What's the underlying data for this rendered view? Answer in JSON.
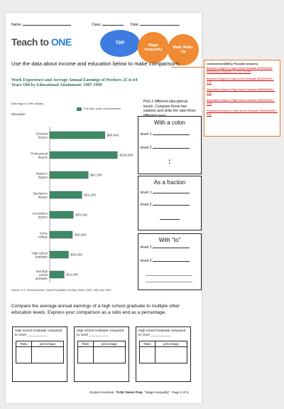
{
  "header": {
    "name_label": "Name:",
    "class_label": "Class:",
    "date_label": "Date:"
  },
  "logo": {
    "part1": "Teach to ",
    "part2": "ONE"
  },
  "bubbles": {
    "tdp": "TDP",
    "wage": "Wage Inequality",
    "math": "Math Write-Up"
  },
  "instruction": "Use the data about income and education below to make comparisons.",
  "chart_data": {
    "type": "bar",
    "title": "Work Experience and Average Annual Earnings of Workers 25 to 64 Years Old by Educational Attainment: 1997-1999",
    "subtitle": "(Earnings in 1999 dollars)",
    "ylabel": "Education",
    "legend": "Full-time, year-round workers",
    "categories": [
      "Doctoral degree",
      "Professional degree",
      "Master's degree",
      "Bachelor's degree",
      "Associate's degree",
      "Some college",
      "High school graduate",
      "Not high school graduate"
    ],
    "values": [
      89400,
      109600,
      62300,
      52200,
      38200,
      36800,
      30400,
      23400
    ],
    "value_labels": [
      "$89,400",
      "$109,600",
      "$62,300",
      "$52,200",
      "$38,200",
      "$36,800",
      "$30,400",
      "$23,400"
    ],
    "xlim": [
      0,
      115000
    ],
    "bar_color": "#3f8a66",
    "source": "Source: U.S. Census Bureau, Current Population Surveys, March 1998, 1999, and 2000."
  },
  "pick_instructions": "Pick 2 different educational levels. Compare those two salaries and write the ratio three different ways.",
  "panels": [
    {
      "title": "With a colon",
      "level1": "level 1",
      "level2": "level 2",
      "symbol": ":"
    },
    {
      "title": "As a fraction",
      "level1": "level 1",
      "level2": "level 2"
    },
    {
      "title": "With \"to\"",
      "level1": "level 1",
      "level2": "level 2"
    }
  ],
  "compare_text": "Compare the average annual earnings of a high school graduate to multiple other education levels.  Express your comparison as a ratio and as a percentage.",
  "compare_boxes": [
    {
      "title": "High school Graduate compared to: level ___________",
      "col1": "Ratio",
      "col2": "percentage"
    },
    {
      "title": "High school Graduate compared to: level ___________",
      "col1": "Ratio",
      "col2": "percentage"
    },
    {
      "title": "High school Graduate compared to: level ___________",
      "col1": "Ratio",
      "col2": "percentage"
    }
  ],
  "footer": {
    "a": "Student Handout",
    "b": "TASK Demo Prep",
    "c": "\"Wage Inequality\"",
    "d": "Page 4 of 6"
  },
  "comment": {
    "head": "Commented [MM1]: Possible answers:",
    "entries": [
      "Bachelor's Degree to High School Graduate 52200/30400: 5220/3040 or 261/152 = 1.717; 171.7%",
      "Bachelor's Degree to High School Graduate 52200/30400 ≈ 1.72",
      "Associate's Degree to High School Graduate 38200/30400 ≈ 1.26",
      "Associate's Degree to High School Graduate 38200/30400 ≈ 1.26",
      "Professional Degree to High School Graduate 109600/30400 ≈ 3.61"
    ]
  }
}
